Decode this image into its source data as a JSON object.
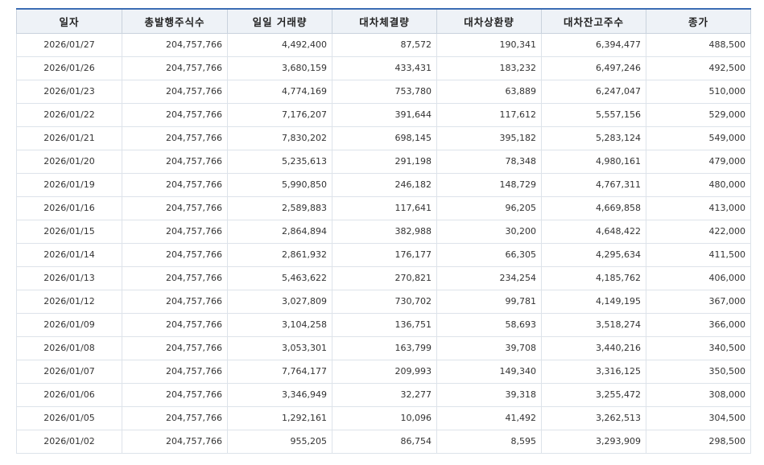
{
  "table": {
    "headers": [
      "일자",
      "총발행주식수",
      "일일 거래량",
      "대차체결량",
      "대차상환량",
      "대차잔고주수",
      "종가"
    ],
    "rows": [
      [
        "2026/01/27",
        "204,757,766",
        "4,492,400",
        "87,572",
        "190,341",
        "6,394,477",
        "488,500"
      ],
      [
        "2026/01/26",
        "204,757,766",
        "3,680,159",
        "433,431",
        "183,232",
        "6,497,246",
        "492,500"
      ],
      [
        "2026/01/23",
        "204,757,766",
        "4,774,169",
        "753,780",
        "63,889",
        "6,247,047",
        "510,000"
      ],
      [
        "2026/01/22",
        "204,757,766",
        "7,176,207",
        "391,644",
        "117,612",
        "5,557,156",
        "529,000"
      ],
      [
        "2026/01/21",
        "204,757,766",
        "7,830,202",
        "698,145",
        "395,182",
        "5,283,124",
        "549,000"
      ],
      [
        "2026/01/20",
        "204,757,766",
        "5,235,613",
        "291,198",
        "78,348",
        "4,980,161",
        "479,000"
      ],
      [
        "2026/01/19",
        "204,757,766",
        "5,990,850",
        "246,182",
        "148,729",
        "4,767,311",
        "480,000"
      ],
      [
        "2026/01/16",
        "204,757,766",
        "2,589,883",
        "117,641",
        "96,205",
        "4,669,858",
        "413,000"
      ],
      [
        "2026/01/15",
        "204,757,766",
        "2,864,894",
        "382,988",
        "30,200",
        "4,648,422",
        "422,000"
      ],
      [
        "2026/01/14",
        "204,757,766",
        "2,861,932",
        "176,177",
        "66,305",
        "4,295,634",
        "411,500"
      ],
      [
        "2026/01/13",
        "204,757,766",
        "5,463,622",
        "270,821",
        "234,254",
        "4,185,762",
        "406,000"
      ],
      [
        "2026/01/12",
        "204,757,766",
        "3,027,809",
        "730,702",
        "99,781",
        "4,149,195",
        "367,000"
      ],
      [
        "2026/01/09",
        "204,757,766",
        "3,104,258",
        "136,751",
        "58,693",
        "3,518,274",
        "366,000"
      ],
      [
        "2026/01/08",
        "204,757,766",
        "3,053,301",
        "163,799",
        "39,708",
        "3,440,216",
        "340,500"
      ],
      [
        "2026/01/07",
        "204,757,766",
        "7,764,177",
        "209,993",
        "149,340",
        "3,316,125",
        "350,500"
      ],
      [
        "2026/01/06",
        "204,757,766",
        "3,346,949",
        "32,277",
        "39,318",
        "3,255,472",
        "308,000"
      ],
      [
        "2026/01/05",
        "204,757,766",
        "1,292,161",
        "10,096",
        "41,492",
        "3,262,513",
        "304,500"
      ],
      [
        "2026/01/02",
        "204,757,766",
        "955,205",
        "86,754",
        "8,595",
        "3,293,909",
        "298,500"
      ]
    ]
  },
  "colors": {
    "header_bg": "#eef2f7",
    "header_top_border": "#3c6db4",
    "grid": "#dde3ea",
    "text": "#333333"
  }
}
